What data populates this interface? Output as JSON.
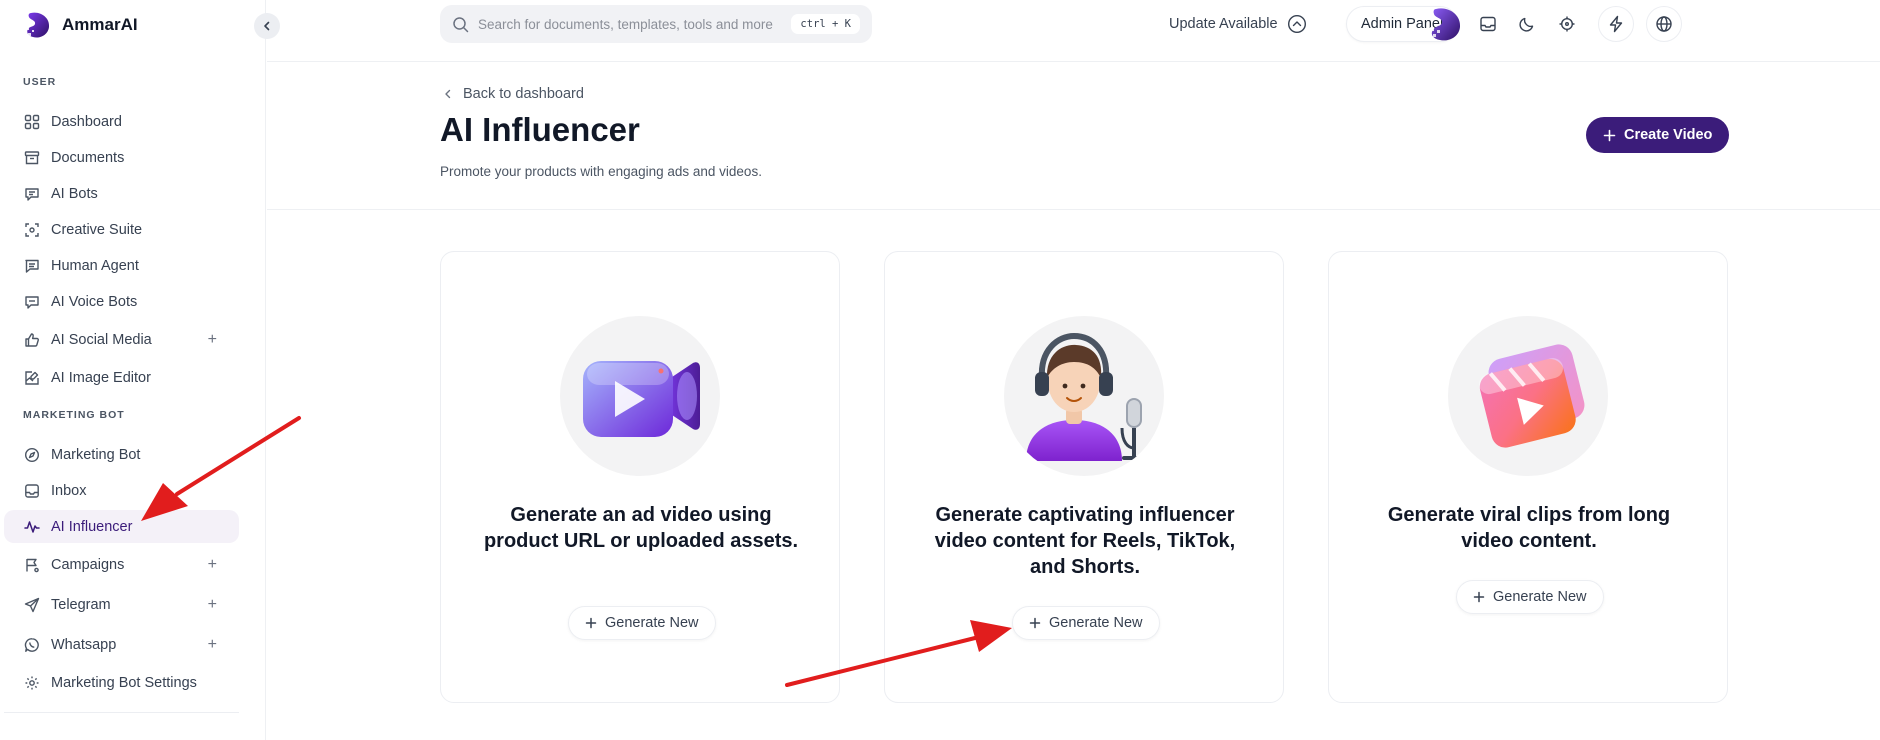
{
  "brand": {
    "name": "AmmarAI"
  },
  "sidebar": {
    "user_label": "USER",
    "marketing_label": "MARKETING BOT",
    "items": [
      {
        "label": "Dashboard"
      },
      {
        "label": "Documents"
      },
      {
        "label": "AI Bots"
      },
      {
        "label": "Creative Suite"
      },
      {
        "label": "Human Agent"
      },
      {
        "label": "AI Voice Bots"
      },
      {
        "label": "AI Social Media",
        "expand": "+"
      },
      {
        "label": "AI Image Editor"
      },
      {
        "label": "Marketing Bot"
      },
      {
        "label": "Inbox"
      },
      {
        "label": "AI Influencer",
        "active": true
      },
      {
        "label": "Campaigns",
        "expand": "+"
      },
      {
        "label": "Telegram",
        "expand": "+"
      },
      {
        "label": "Whatsapp",
        "expand": "+"
      },
      {
        "label": "Marketing Bot Settings"
      }
    ]
  },
  "topbar": {
    "search_placeholder": "Search for documents, templates, tools and more",
    "shortcut": "ctrl + K",
    "update_label": "Update Available",
    "admin_label": "Admin Panel"
  },
  "header": {
    "back_label": "Back to dashboard",
    "title": "AI Influencer",
    "subtitle": "Promote your products with engaging ads and videos.",
    "create_label": "Create Video"
  },
  "cards": [
    {
      "title": "Generate an ad video using product URL or uploaded assets.",
      "button": "Generate New",
      "icon": "video-camera-icon"
    },
    {
      "title": "Generate captivating influencer video content for Reels, TikTok, and Shorts.",
      "button": "Generate New",
      "icon": "podcaster-avatar-icon"
    },
    {
      "title": "Generate viral clips from long video content.",
      "button": "Generate New",
      "icon": "video-clip-icon"
    }
  ],
  "colors": {
    "brand_purple": "#3b1c7a",
    "active_bg": "#f4f1f8",
    "annotation_red": "#e11d1d"
  }
}
